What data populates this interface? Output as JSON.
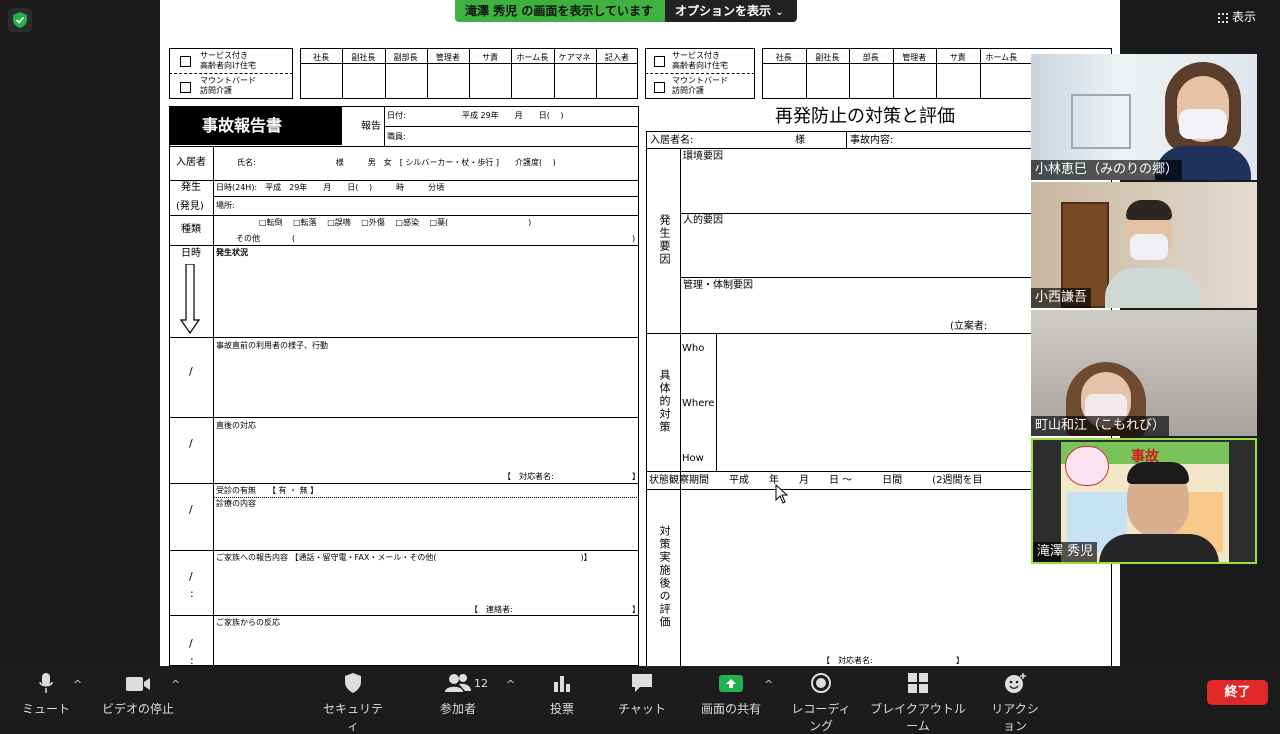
{
  "share_banner": {
    "text": "滝澤 秀児 の画面を表示しています",
    "options_label": "オプションを表示"
  },
  "view_label": "表示",
  "left_form": {
    "facility_1": "サービス付き",
    "facility_1b": "高齢者向け住宅",
    "facility_2": "マウントバード",
    "facility_2b": "訪問介護",
    "roles": [
      "社長",
      "副社長",
      "副部長",
      "管理者",
      "サ責",
      "ホーム長",
      "ケアマネ",
      "記入者"
    ],
    "title": "事故報告書",
    "report_label": "報告",
    "date_label": "日付:",
    "date_value": "平成 29年　　月　　日(　 )",
    "staff_label": "職員:",
    "resident_label": "入居者",
    "resident_row": "氏名:　　　　　　　　　　様　　　男　女　[ シルバーカー・杖・歩行 ]　　介護度(　 )",
    "occur_label": "発生",
    "occur_label2": "(発見)",
    "occur_time": "日時(24H):　平成　29年　　月　　日(　 )　　　時　　　分頃",
    "place": "場所:",
    "type_label": "種類",
    "types": "□転倒　 □転落　 □誤嚥　 □外傷　 □感染　 □薬(　　　　　　　　　　)",
    "other": "その他　　　　(",
    "other_close": ")",
    "time_col": "日時",
    "situation": "発生状況",
    "before": "事故直前の利用者の様子、行動",
    "after": "直後の対応",
    "responder": "【　対応者名:",
    "bracket_close": "】",
    "visit": "受診の有無　　【 有 ・ 無 】",
    "treatment": "診療の内容",
    "family_report": "ご家族への報告内容 【通話・留守電・FAX・メール・その他(　　　　　　　　　　　　　　　　　　)】",
    "contact": "【　連絡者:",
    "family_reaction": "ご家族からの反応",
    "slash": "/",
    "colon": ":"
  },
  "right_form": {
    "roles": [
      "社長",
      "副社長",
      "部長",
      "管理者",
      "サ責",
      "ホーム長"
    ],
    "title": "再発防止の対策と評価",
    "resident": "入居者名:",
    "sama": "様",
    "incident": "事故内容:",
    "cause_label": "発生要因",
    "env": "環境要因",
    "human": "人的要因",
    "mgmt": "管理・体制要因",
    "planner": "(立案者:",
    "measure_label": "具体的対策",
    "who": "Who",
    "where": "Where",
    "how": "How",
    "period": "状態観察期間　　平成　　年　　月　　日 〜　　　日間　　　(2週間を目",
    "eval_label": "対策実施後の評価",
    "responder": "【　対応者名:",
    "bracket_close": "】"
  },
  "participants": [
    {
      "name": "小林恵巳（みのりの郷）"
    },
    {
      "name": "小西謙吾"
    },
    {
      "name": "町山和江（こもれび）"
    },
    {
      "name": "滝澤 秀児"
    }
  ],
  "poster_text": "事故",
  "toolbar": {
    "mute": "ミュート",
    "video": "ビデオの停止",
    "security": "セキュリティ",
    "participants": "参加者",
    "participants_count": "12",
    "polls": "投票",
    "chat": "チャット",
    "share": "画面の共有",
    "record": "レコーディング",
    "breakout": "ブレイクアウトルーム",
    "reactions": "リアクション",
    "end": "終了"
  },
  "colors": {
    "banner_green": "#3fb13f",
    "active_border": "#9be03f",
    "end_red": "#e02828",
    "share_green": "#22b14c"
  }
}
